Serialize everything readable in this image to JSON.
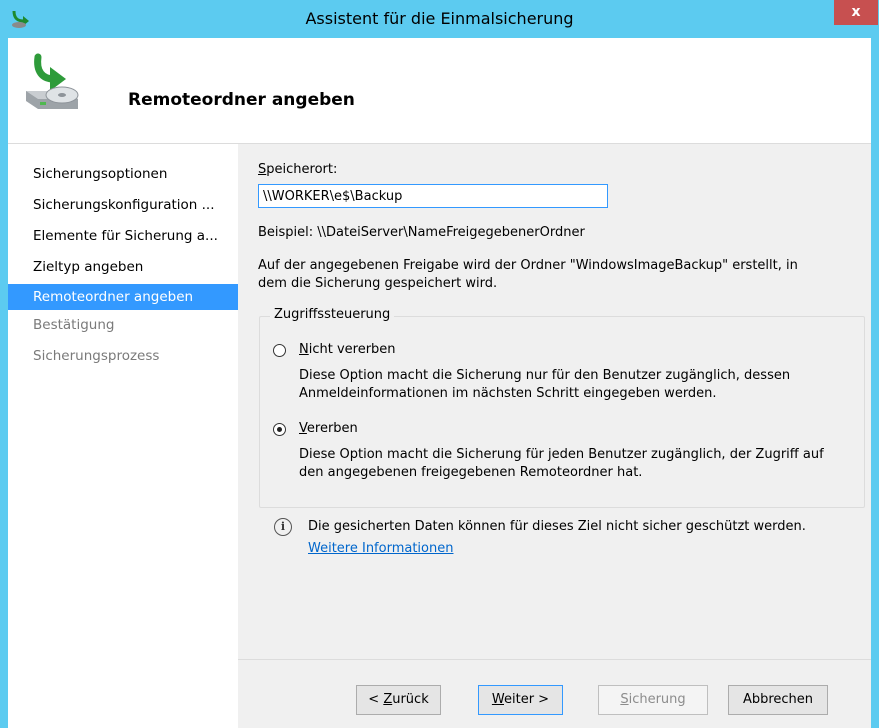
{
  "window": {
    "title": "Assistent für die Einmalsicherung",
    "close_label": "x"
  },
  "header": {
    "title": "Remoteordner angeben"
  },
  "sidebar": {
    "items": [
      {
        "label": "Sicherungsoptionen",
        "state": "done"
      },
      {
        "label": "Sicherungskonfiguration ...",
        "state": "done"
      },
      {
        "label": "Elemente für Sicherung a...",
        "state": "done"
      },
      {
        "label": "Zieltyp angeben",
        "state": "done"
      },
      {
        "label": "Remoteordner angeben",
        "state": "active"
      },
      {
        "label": "Bestätigung",
        "state": "disabled"
      },
      {
        "label": "Sicherungsprozess",
        "state": "disabled"
      }
    ]
  },
  "form": {
    "location_label_u": "S",
    "location_label_rest": "peicherort:",
    "location_value": "\\\\WORKER\\e$\\Backup",
    "example": "Beispiel: \\\\DateiServer\\NameFreigegebenerOrdner",
    "description_line1": "Auf der angegebenen Freigabe wird der Ordner \"WindowsImageBackup\" erstellt, in",
    "description_line2": "dem die Sicherung gespeichert wird."
  },
  "access": {
    "group_title": "Zugriffssteuerung",
    "options": [
      {
        "label_u": "N",
        "label_rest": "icht vererben",
        "checked": false,
        "desc_line1": "Diese Option macht die Sicherung nur für den Benutzer zugänglich, dessen",
        "desc_line2": "Anmeldeinformationen im nächsten Schritt eingegeben werden."
      },
      {
        "label_u": "V",
        "label_rest": "ererben",
        "checked": true,
        "desc_line1": "Diese Option macht die Sicherung für jeden Benutzer zugänglich, der Zugriff auf",
        "desc_line2": "den angegebenen freigegebenen Remoteordner hat."
      }
    ]
  },
  "info": {
    "icon_glyph": "i",
    "text": "Die gesicherten Daten können für dieses Ziel nicht sicher geschützt werden.",
    "link": "Weitere Informationen"
  },
  "buttons": {
    "back_prefix": "< ",
    "back_u": "Z",
    "back_rest": "urück",
    "next_u": "W",
    "next_rest": "eiter >",
    "backup_u": "S",
    "backup_rest": "icherung",
    "cancel": "Abbrechen"
  },
  "colors": {
    "titlebar": "#5ccbf0",
    "close": "#c75050",
    "selection": "#3399ff",
    "link": "#0066cc"
  }
}
